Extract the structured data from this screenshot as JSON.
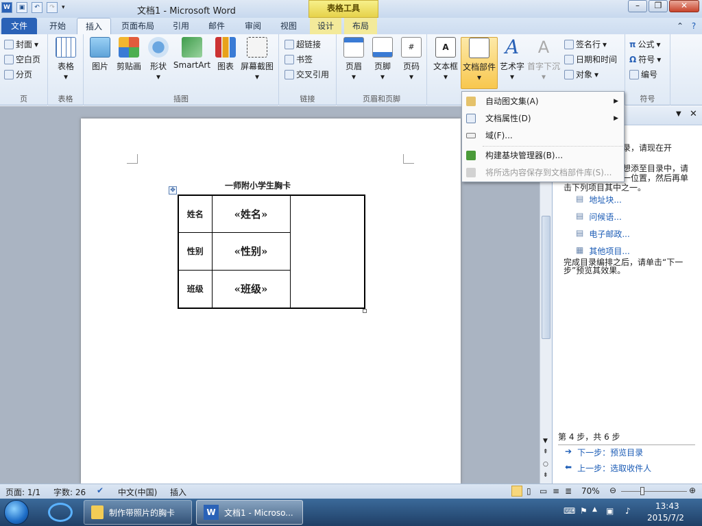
{
  "window": {
    "title": "文档1 - Microsoft Word",
    "context_tab_group": "表格工具"
  },
  "tabs": [
    "文件",
    "开始",
    "插入",
    "页面布局",
    "引用",
    "邮件",
    "审阅",
    "视图",
    "设计",
    "布局"
  ],
  "ribbon": {
    "pages": {
      "label": "页",
      "items": [
        "封面",
        "空白页",
        "分页"
      ]
    },
    "tables": {
      "label": "表格",
      "item": "表格"
    },
    "illustrations": {
      "label": "插图",
      "items": [
        "图片",
        "剪贴画",
        "形状",
        "SmartArt",
        "图表",
        "屏幕截图"
      ]
    },
    "links": {
      "label": "链接",
      "items": [
        "超链接",
        "书签",
        "交叉引用"
      ]
    },
    "header_footer": {
      "label": "页眉和页脚",
      "items": [
        "页眉",
        "页脚",
        "页码"
      ]
    },
    "text": {
      "items": [
        "文本框",
        "文档部件",
        "艺术字",
        "首字下沉"
      ],
      "small": [
        "签名行",
        "日期和时间",
        "对象"
      ]
    },
    "symbols": {
      "label": "符号",
      "items": [
        "公式",
        "符号",
        "编号"
      ]
    }
  },
  "dropdown": {
    "items": [
      "自动图文集(A)",
      "文档属性(D)",
      "域(F)...",
      "构建基块管理器(B)...",
      "将所选内容保存到文档部件库(S)..."
    ]
  },
  "document": {
    "title": "一师附小学生胸卡",
    "rows": [
      {
        "label": "姓名",
        "field": "«姓名»"
      },
      {
        "label": "性别",
        "field": "«性别»"
      },
      {
        "label": "班级",
        "field": "«班级»"
      }
    ]
  },
  "taskpane": {
    "partial_text_1": "录，请现在开",
    "partial_text_2": "想添至目录中，请",
    "partial_text_3": "一位置，然后再单",
    "partial_text_4": "击下列项目其中之一。",
    "links": [
      "地址块...",
      "问候语...",
      "电子邮政...",
      "其他项目..."
    ],
    "after_text": "完成目录编排之后，请单击“下一步”预览其效果。",
    "step": "第 4 步，共 6 步",
    "next": "下一步：预览目录",
    "prev": "上一步：选取收件人"
  },
  "status": {
    "page": "页面: 1/1",
    "words": "字数: 26",
    "lang": "中文(中国)",
    "mode": "插入",
    "zoom": "70%"
  },
  "taskbar": {
    "items": [
      "制作带照片的胸卡",
      "文档1 - Microso..."
    ],
    "time": "13:43",
    "date": "2015/7/2"
  }
}
